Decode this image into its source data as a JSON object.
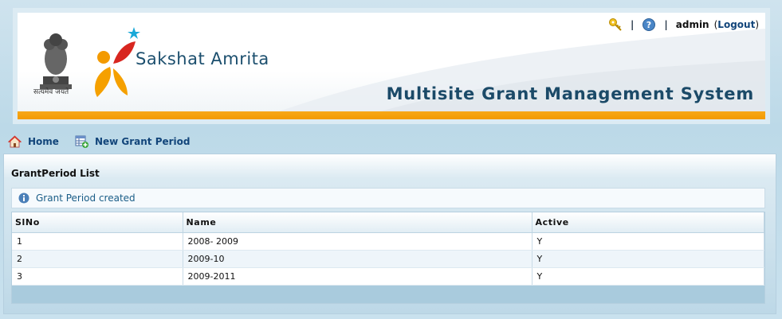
{
  "header": {
    "emblem_caption": "सत्यमेव जयते",
    "brand_name": "Sakshat Amrita",
    "app_title": "Multisite Grant Management System",
    "separator": "|",
    "user": "admin",
    "logout_prefix": "(",
    "logout_label": "Logout",
    "logout_suffix": ")"
  },
  "nav": {
    "home_label": "Home",
    "new_grant_period_label": "New Grant Period"
  },
  "panel": {
    "title": "GrantPeriod List",
    "message": "Grant Period created"
  },
  "table": {
    "columns": [
      "SlNo",
      "Name",
      "Active"
    ],
    "rows": [
      {
        "slno": "1",
        "name": "2008- 2009",
        "active": "Y"
      },
      {
        "slno": "2",
        "name": "2009-10",
        "active": "Y"
      },
      {
        "slno": "3",
        "name": "2009-2011",
        "active": "Y"
      }
    ]
  },
  "colors": {
    "accent": "#12457a",
    "orange_bar": "#f39a00",
    "title": "#1b4a68"
  }
}
